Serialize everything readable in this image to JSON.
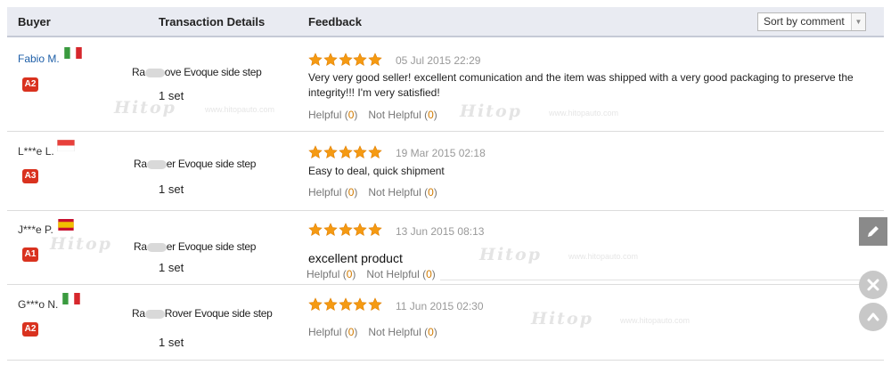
{
  "header": {
    "buyer": "Buyer",
    "transaction": "Transaction Details",
    "feedback": "Feedback",
    "sort": "Sort by comment"
  },
  "colors": {
    "accent": "#1e5fa8",
    "badge": "#d9321f",
    "star": "#f59a12",
    "count": "#d07a00"
  },
  "watermark": {
    "text": "Hitop",
    "url": "www.hitopauto.com"
  },
  "reviews": [
    {
      "buyer": "Fabio M.",
      "flag": "italy-flag",
      "badge": "A2",
      "product_a": "Ra",
      "product_b": "ove Evoque side step",
      "product_b2": "Rover Evoque side step",
      "quantity": "1 set",
      "rating": 5,
      "date": "05 Jul 2015 22:29",
      "comment": "Very very good seller! excellent comunication and the item was shipped with a very good packaging to preserve the integrity!!! I'm very satisfied!",
      "helpful_label": "Helpful",
      "helpful_count": "0",
      "not_helpful_label": "Not Helpful",
      "not_helpful_count": "0"
    },
    {
      "buyer": "L***e L.",
      "flag": "singapore-flag",
      "badge": "A3",
      "product_a": "Ra",
      "product_b": "er Evoque side step",
      "quantity": "1 set",
      "rating": 5,
      "date": "19 Mar 2015 02:18",
      "comment": "Easy to deal, quick shipment",
      "helpful_label": "Helpful",
      "helpful_count": "0",
      "not_helpful_label": "Not Helpful",
      "not_helpful_count": "0"
    },
    {
      "buyer": "J***e P.",
      "flag": "spain-flag",
      "badge": "A1",
      "product_a": "Ra",
      "product_b": "er Evoque side step",
      "quantity": "1 set",
      "rating": 5,
      "date": "13 Jun 2015 08:13",
      "comment": "excellent product",
      "helpful_label": "Helpful",
      "helpful_count": "0",
      "not_helpful_label": "Not Helpful",
      "not_helpful_count": "0"
    },
    {
      "buyer": "G***o N.",
      "flag": "italy-flag",
      "badge": "A2",
      "product_a": "Ra",
      "product_b": "Rover Evoque side step",
      "quantity": "1 set",
      "rating": 5,
      "date": "11 Jun 2015 02:30",
      "comment": "",
      "helpful_label": "Helpful",
      "helpful_count": "0",
      "not_helpful_label": "Not Helpful",
      "not_helpful_count": "0"
    }
  ],
  "side_tools": {
    "edit": "pencil-icon",
    "close": "close-icon",
    "top": "chevron-up-icon"
  }
}
